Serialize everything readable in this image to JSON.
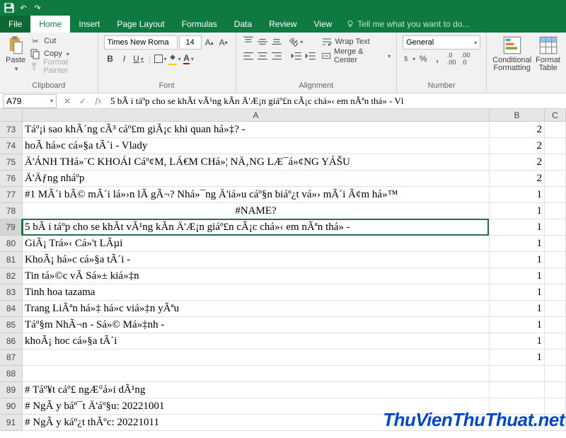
{
  "tabs": {
    "file": "File",
    "home": "Home",
    "insert": "Insert",
    "page_layout": "Page Layout",
    "formulas": "Formulas",
    "data": "Data",
    "review": "Review",
    "view": "View",
    "tell_me": "Tell me what you want to do..."
  },
  "clipboard": {
    "paste": "Paste",
    "cut": "Cut",
    "copy": "Copy",
    "format_painter": "Format Painter",
    "label": "Clipboard"
  },
  "font": {
    "name": "Times New Roma",
    "size": "14",
    "label": "Font"
  },
  "alignment": {
    "wrap": "Wrap Text",
    "merge": "Merge & Center",
    "label": "Alignment"
  },
  "number": {
    "format": "General",
    "label": "Number"
  },
  "styles": {
    "conditional": "Conditional\nFormatting",
    "format_table": "Format\nTable"
  },
  "name_box": "A79",
  "formula": "5 bÃ i táº­p cho se khÃ­t vÃ¹ng kÃ­n Ä'Æ¡n giáº£n cÃ¡c chá»‹ em nÃªn thá»­ - Vl",
  "col_headers": {
    "A": "A",
    "B": "B",
    "C": "C"
  },
  "rows": [
    {
      "n": "73",
      "a": "Táº¡i sao khÃ´ng cÃ³ cáº£m giÃ¡c khi quan há»‡? -",
      "b": "2"
    },
    {
      "n": "74",
      "a": "hoÃ  há»c cá»§a tÃ´i - Vlady",
      "b": "2"
    },
    {
      "n": "75",
      "a": "Ä'ÁNH THá»¨C KHOÁI Cáº¢M, LÁ€M CHá»¦ NÄ‚NG LÆ¯á»¢NG YÁŠU",
      "b": "2"
    },
    {
      "n": "76",
      "a": "Ä'Äƒng nháº­p",
      "b": "2"
    },
    {
      "n": "77",
      "a": "#1 MÃ´i bÃ© mÃ´i lá»›n lÃ   gÃ¬? Nhá»¯ng Ä'iá»u cáº§n biáº¿t vá»› mÃ´i Ã¢m há»™",
      "b": "1"
    },
    {
      "n": "78",
      "a": "#NAME?",
      "b": "1",
      "center": true
    },
    {
      "n": "79",
      "a": "5 bÃ i táº­p cho se khÃ­t vÃ¹ng kÃ­n Ä'Æ¡n giáº£n cÃ¡c chá»‹ em nÃªn thá»­ -",
      "b": "1",
      "sel": true
    },
    {
      "n": "80",
      "a": "GiÃ¡ Trá»‹ Cá»'t LÃµi",
      "b": "1"
    },
    {
      "n": "81",
      "a": "KhoÃ¡ há»c cá»§a tÃ´i -",
      "b": "1"
    },
    {
      "n": "82",
      "a": "Tin tá»©c vÃ   Sá»± kiá»‡n",
      "b": "1"
    },
    {
      "n": "83",
      "a": "Tinh hoa tazama",
      "b": "1"
    },
    {
      "n": "84",
      "a": "Trang LiÃªn há»‡ há»c viá»‡n yÃªu",
      "b": "1"
    },
    {
      "n": "85",
      "a": "Táº§m NhÃ¬n - Sá»© Má»‡nh -",
      "b": "1"
    },
    {
      "n": "86",
      "a": "khoÃ¡ hoc cá»§a tÃ´i",
      "b": "1"
    },
    {
      "n": "87",
      "a": "",
      "b": "1"
    },
    {
      "n": "88",
      "a": "",
      "b": ""
    },
    {
      "n": "89",
      "a": "# Táº¥t cáº£ ngÆ°á»i dÃ¹ng",
      "b": ""
    },
    {
      "n": "90",
      "a": "# NgÃ y báº¯t Ä'áº§u: 20221001",
      "b": ""
    },
    {
      "n": "91",
      "a": "# NgÃ y káº¿t thÃºc: 20221011",
      "b": ""
    }
  ],
  "watermark": "ThuVienThuThuat.net"
}
